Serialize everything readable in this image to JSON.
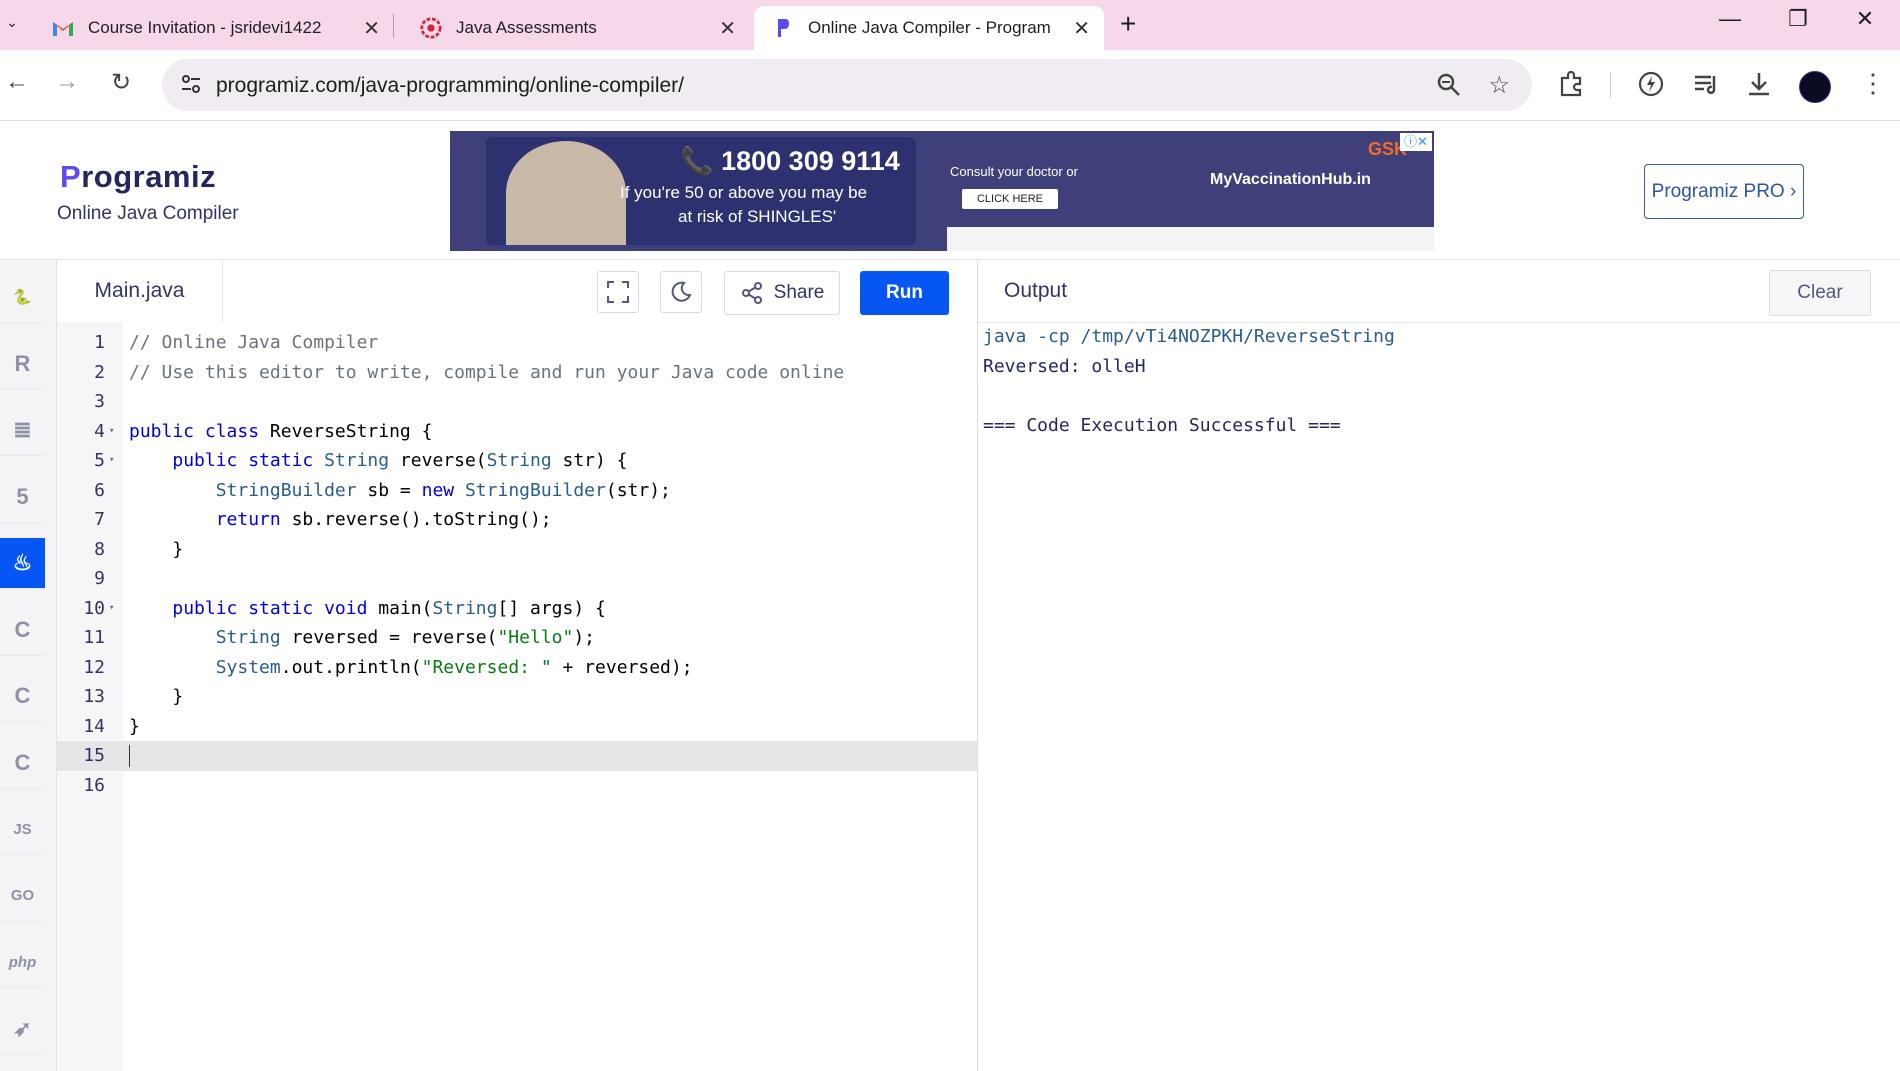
{
  "browser": {
    "tabs": [
      {
        "title": "Course Invitation - jsridevi1422",
        "icon": "gmail-icon",
        "active": false
      },
      {
        "title": "Java Assessments",
        "icon": "assessment-icon",
        "active": false
      },
      {
        "title": "Online Java Compiler - Program",
        "icon": "programiz-icon",
        "active": true
      }
    ],
    "url": "programiz.com/java-programming/online-compiler/"
  },
  "header": {
    "logo": "rogramiz",
    "logo_initial": "P",
    "subtitle": "Online Java Compiler",
    "pro_button": "Programiz PRO ›"
  },
  "ad": {
    "phone": "📞 1800 309 9114",
    "msg1": "If you're 50 or above you may be",
    "msg2": "at risk of SHINGLES'",
    "consult": "Consult your doctor or",
    "click": "CLICK HERE",
    "site": "MyVaccinationHub.in",
    "brand": "GSK"
  },
  "rail": {
    "languages": [
      {
        "name": "python",
        "glyph": "🐍",
        "active": false
      },
      {
        "name": "r",
        "glyph": "R",
        "active": false
      },
      {
        "name": "sql",
        "glyph": "≣",
        "active": false
      },
      {
        "name": "html",
        "glyph": "5",
        "active": false
      },
      {
        "name": "java",
        "glyph": "♨",
        "active": true
      },
      {
        "name": "c",
        "glyph": "C",
        "active": false
      },
      {
        "name": "cpp",
        "glyph": "C",
        "active": false
      },
      {
        "name": "csharp",
        "glyph": "C",
        "active": false
      },
      {
        "name": "js",
        "glyph": "JS",
        "active": false
      },
      {
        "name": "go",
        "glyph": "GO",
        "active": false
      },
      {
        "name": "php",
        "glyph": "php",
        "active": false
      },
      {
        "name": "swift",
        "glyph": "➶",
        "active": false
      }
    ]
  },
  "editor": {
    "filename": "Main.java",
    "share_label": "Share",
    "run_label": "Run",
    "current_line": 15,
    "lines": [
      [
        [
          "cm",
          "// Online Java Compiler"
        ]
      ],
      [
        [
          "cm",
          "// Use this editor to write, compile and run your Java code online"
        ]
      ],
      [],
      [
        [
          "kw",
          "public class "
        ],
        [
          "",
          "ReverseString {"
        ]
      ],
      [
        [
          "",
          "    "
        ],
        [
          "kw",
          "public static "
        ],
        [
          "ty",
          "String "
        ],
        [
          "",
          "reverse("
        ],
        [
          "ty",
          "String "
        ],
        [
          "",
          "str) {"
        ]
      ],
      [
        [
          "",
          "        "
        ],
        [
          "ty",
          "StringBuilder "
        ],
        [
          "",
          "sb = "
        ],
        [
          "kw",
          "new "
        ],
        [
          "ty",
          "StringBuilder"
        ],
        [
          "",
          "(str);"
        ]
      ],
      [
        [
          "",
          "        "
        ],
        [
          "kw",
          "return "
        ],
        [
          "",
          "sb.reverse().toString();"
        ]
      ],
      [
        [
          "",
          "    }"
        ]
      ],
      [],
      [
        [
          "",
          "    "
        ],
        [
          "kw",
          "public static void "
        ],
        [
          "",
          "main("
        ],
        [
          "ty",
          "String"
        ],
        [
          "",
          "[] args) {"
        ]
      ],
      [
        [
          "",
          "        "
        ],
        [
          "ty",
          "String "
        ],
        [
          "",
          "reversed = reverse("
        ],
        [
          "st",
          "\"Hello\""
        ],
        [
          "",
          ");"
        ]
      ],
      [
        [
          "",
          "        "
        ],
        [
          "ty",
          "System"
        ],
        [
          "",
          ".out.println("
        ],
        [
          "st",
          "\"Reversed: \""
        ],
        [
          "",
          " + reversed);"
        ]
      ],
      [
        [
          "",
          "    }"
        ]
      ],
      [
        [
          "",
          "}"
        ]
      ],
      [],
      []
    ],
    "foldable": [
      4,
      5,
      10
    ]
  },
  "output": {
    "title": "Output",
    "clear_label": "Clear",
    "lines": [
      "java -cp /tmp/vTi4NOZPKH/ReverseString",
      "Reversed: olleH",
      "",
      "=== Code Execution Successful ==="
    ]
  }
}
